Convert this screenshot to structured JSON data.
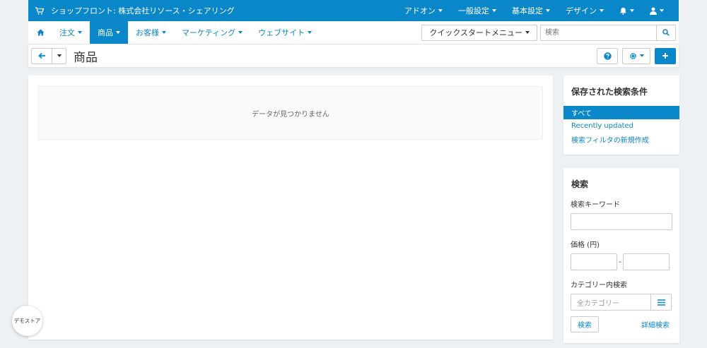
{
  "header": {
    "store_name": "ショップフロント: 株式会社リソース・シェアリング",
    "menus": [
      "アドオン",
      "一般設定",
      "基本設定",
      "デザイン"
    ]
  },
  "nav": {
    "items": [
      {
        "label": "注文",
        "active": false
      },
      {
        "label": "商品",
        "active": true
      },
      {
        "label": "お客様",
        "active": false
      },
      {
        "label": "マーケティング",
        "active": false
      },
      {
        "label": "ウェブサイト",
        "active": false
      }
    ],
    "quickstart_label": "クイックスタートメニュー",
    "search_placeholder": "検索"
  },
  "page": {
    "title": "商品",
    "no_data": "データが見つかりません"
  },
  "saved_searches": {
    "title": "保存された検索条件",
    "items": [
      {
        "label": "すべて",
        "active": true
      },
      {
        "label": "Recently updated",
        "active": false
      },
      {
        "label": "検索フィルタの新規作成",
        "active": false
      }
    ]
  },
  "filter": {
    "title": "検索",
    "keyword_label": "検索キーワード",
    "price_label": "価格 (円)",
    "price_sep": "-",
    "category_label": "カテゴリー内検索",
    "category_placeholder": "全カテゴリー",
    "search_button": "検索",
    "advanced_link": "詳細検索"
  },
  "demo_badge": "デモストア",
  "colors": {
    "accent": "#0a87c9",
    "background": "#eef1f4"
  },
  "icons": [
    "cart-icon",
    "bell-icon",
    "user-icon",
    "home-icon",
    "search-icon",
    "arrow-left-icon",
    "help-icon",
    "gear-icon",
    "plus-icon",
    "list-icon"
  ]
}
